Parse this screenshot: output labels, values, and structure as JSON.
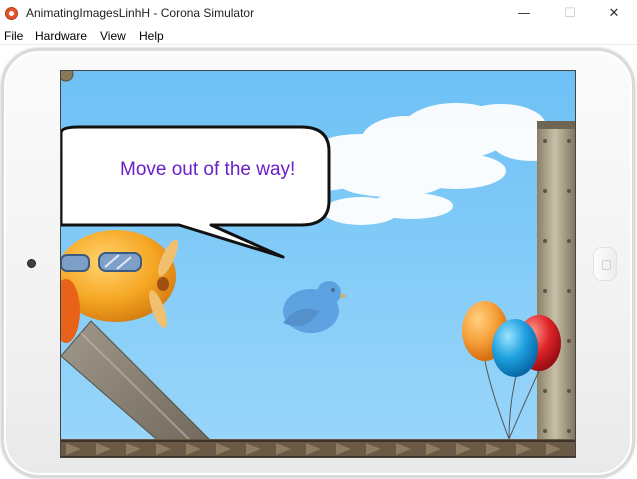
{
  "window": {
    "title": "AnimatingImagesLinhH - Corona Simulator",
    "minimize_glyph": "—",
    "maximize_glyph": "☐",
    "close_glyph": "✕"
  },
  "menu": {
    "items": [
      "File",
      "Hardware",
      "View",
      "Help"
    ]
  },
  "game": {
    "speech_text": "Move out of the way!"
  },
  "colors": {
    "sky": "#86cdf8",
    "speech_text": "#6a20c8",
    "plane_body": "#f5a623",
    "bird": "#3a7fd0",
    "balloon_orange": "#f7a13a",
    "balloon_blue": "#1ea0df",
    "balloon_red": "#e0262a"
  },
  "icons": {
    "app": "corona-icon",
    "camera": "camera-icon",
    "home": "home-button-icon"
  }
}
